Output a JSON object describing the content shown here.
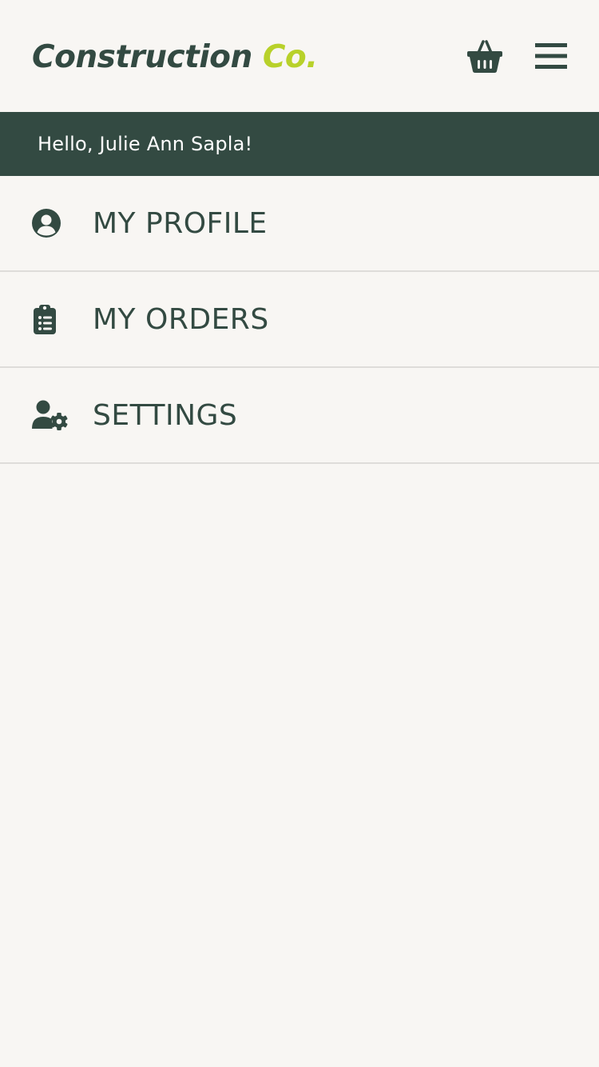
{
  "header": {
    "logo_main": "Construction",
    "logo_accent": "Co.",
    "brand_color": "#334a42",
    "accent_color": "#b8d12a",
    "basket_icon": "basket-icon",
    "menu_icon": "hamburger-menu-icon"
  },
  "greeting": {
    "text": "Hello, Julie Ann Sapla!"
  },
  "menu": {
    "items": [
      {
        "label": "MY PROFILE",
        "icon": "user-circle-icon"
      },
      {
        "label": "MY ORDERS",
        "icon": "clipboard-list-icon"
      },
      {
        "label": "SETTINGS",
        "icon": "user-settings-icon"
      }
    ]
  }
}
